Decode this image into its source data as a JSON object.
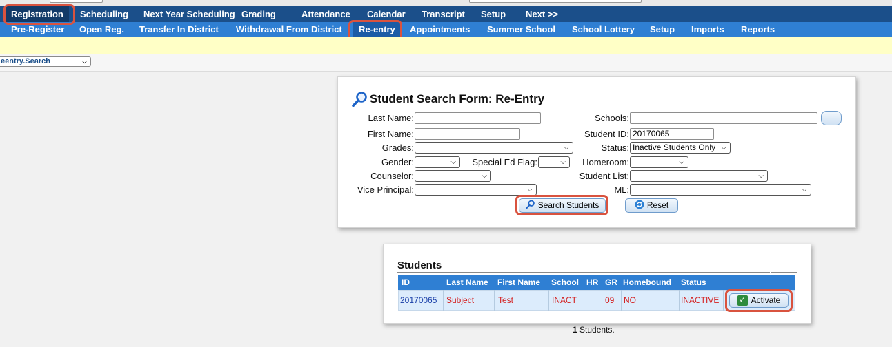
{
  "nav_primary": [
    "Registration",
    "Scheduling",
    "Next Year Scheduling",
    "Grading",
    "Attendance",
    "Calendar",
    "Transcript",
    "Setup",
    "Next >>"
  ],
  "nav_secondary": [
    "Pre-Register",
    "Open Reg.",
    "Transfer In District",
    "Withdrawal From District",
    "Re-entry",
    "Appointments",
    "Summer School",
    "School Lottery",
    "Setup",
    "Imports",
    "Reports"
  ],
  "context_select": "eentry.Search",
  "search_form": {
    "title": "Student Search Form: Re-Entry",
    "labels": {
      "last_name": "Last Name:",
      "first_name": "First Name:",
      "grades": "Grades:",
      "gender": "Gender:",
      "special_ed": "Special Ed Flag:",
      "counselor": "Counselor:",
      "vice_principal": "Vice Principal:",
      "schools": "Schools:",
      "student_id": "Student ID:",
      "status": "Status:",
      "homeroom": "Homeroom:",
      "student_list": "Student List:",
      "ml": "ML:"
    },
    "values": {
      "last_name": "",
      "first_name": "",
      "student_id": "20170065",
      "status": "Inactive Students Only",
      "schools": ""
    },
    "ellipsis_label": "...",
    "search_button": "Search Students",
    "reset_button": "Reset"
  },
  "students": {
    "title": "Students",
    "columns": [
      "ID",
      "Last Name",
      "First Name",
      "School",
      "HR",
      "GR",
      "Homebound",
      "Status"
    ],
    "rows": [
      {
        "id": "20170065",
        "last_name": "Subject",
        "first_name": "Test",
        "school": "INACT",
        "hr": "",
        "gr": "09",
        "homebound": "NO",
        "status": "INACTIVE"
      }
    ],
    "activate_label": "Activate",
    "count": "1",
    "count_suffix": "Students."
  },
  "colors": {
    "nav_primary_bg": "#1b4f8a",
    "nav_secondary_bg": "#2f7fd3",
    "highlight": "#d9533f",
    "table_text": "#d42020"
  }
}
